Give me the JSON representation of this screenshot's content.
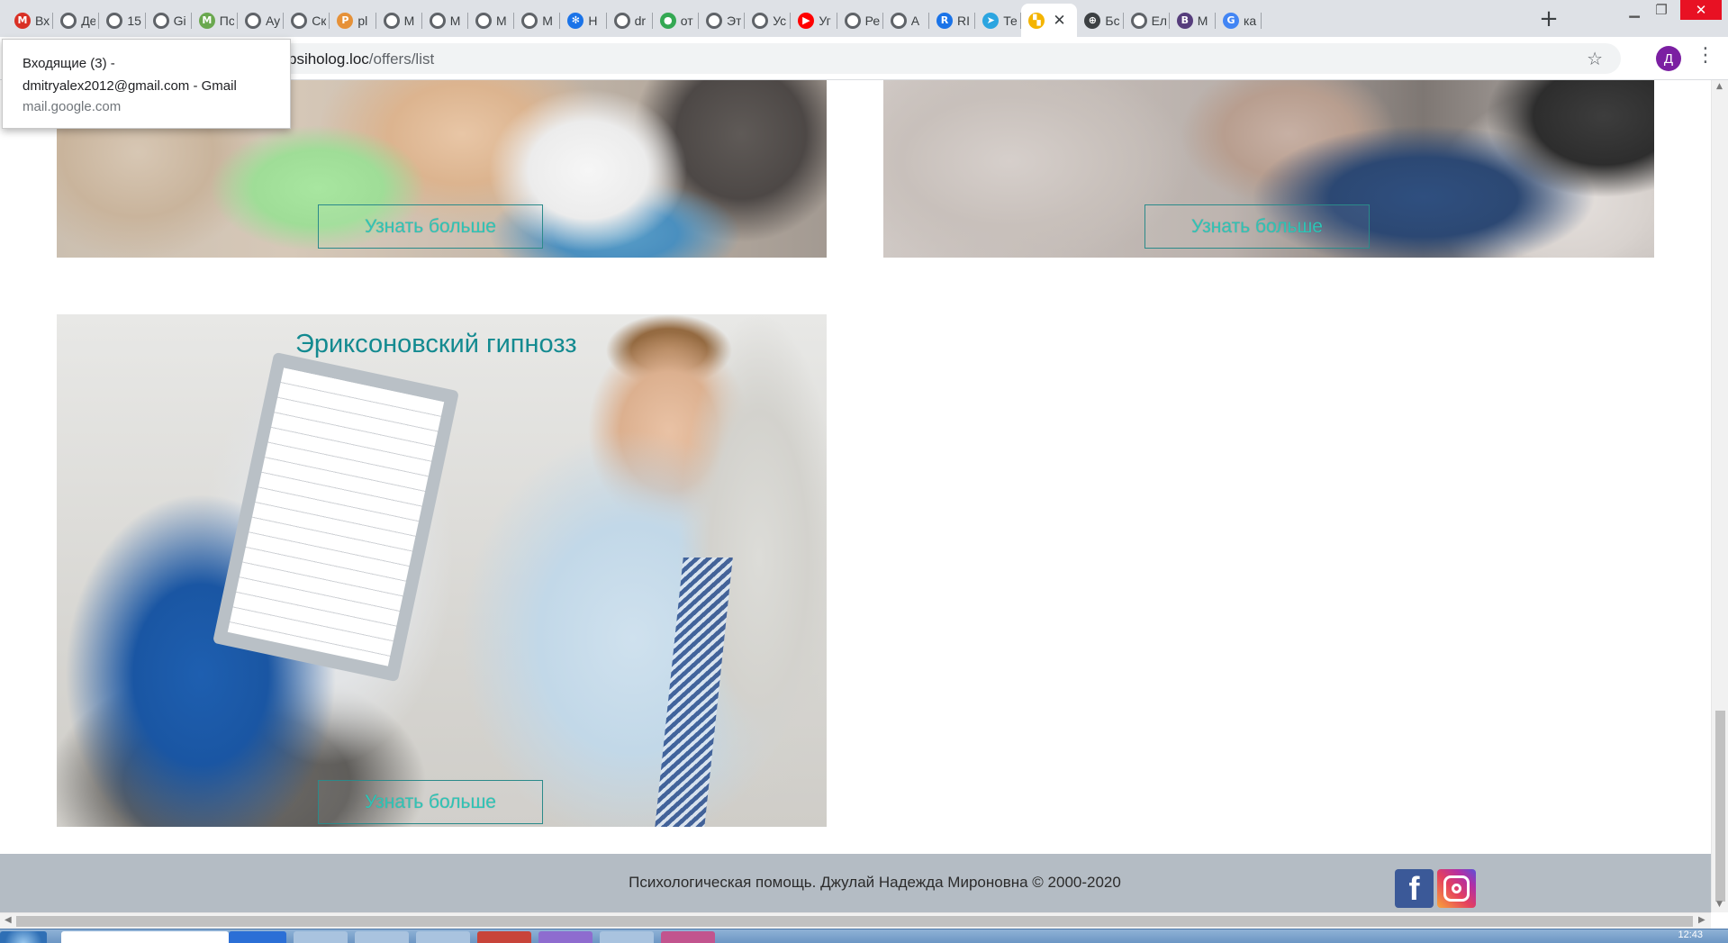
{
  "browser": {
    "tabs": [
      {
        "title": "Входящие (3) - dmitryalex2012@gmail.com - Gmail",
        "icon": "gmail-icon",
        "color": "#d93025",
        "glyph": "M"
      },
      {
        "title": "Де",
        "icon": "globe-icon",
        "color": "#5f6368",
        "glyph": ""
      },
      {
        "title": "15",
        "icon": "globe-icon",
        "color": "#5f6368",
        "glyph": ""
      },
      {
        "title": "Gi",
        "icon": "globe-icon",
        "color": "#5f6368",
        "glyph": ""
      },
      {
        "title": "Пс",
        "icon": "m-logo-icon",
        "color": "#6aa84f",
        "glyph": "M"
      },
      {
        "title": "Ау",
        "icon": "globe-icon",
        "color": "#5f6368",
        "glyph": ""
      },
      {
        "title": "Ск",
        "icon": "globe-icon",
        "color": "#5f6368",
        "glyph": ""
      },
      {
        "title": "pl",
        "icon": "pma-icon",
        "color": "#e69138",
        "glyph": "P"
      },
      {
        "title": "М",
        "icon": "globe-icon",
        "color": "#5f6368",
        "glyph": ""
      },
      {
        "title": "М",
        "icon": "globe-icon",
        "color": "#5f6368",
        "glyph": ""
      },
      {
        "title": "М",
        "icon": "globe-icon",
        "color": "#5f6368",
        "glyph": ""
      },
      {
        "title": "М",
        "icon": "globe-icon",
        "color": "#5f6368",
        "glyph": ""
      },
      {
        "title": "Н",
        "icon": "gear-icon",
        "color": "#1a73e8",
        "glyph": "✻"
      },
      {
        "title": "dr",
        "icon": "globe-icon",
        "color": "#5f6368",
        "glyph": ""
      },
      {
        "title": "от",
        "icon": "maps-pin-icon",
        "color": "#34a853",
        "glyph": "●"
      },
      {
        "title": "Эт",
        "icon": "globe-icon",
        "color": "#5f6368",
        "glyph": ""
      },
      {
        "title": "Ус",
        "icon": "globe-icon",
        "color": "#5f6368",
        "glyph": ""
      },
      {
        "title": "Уг",
        "icon": "youtube-icon",
        "color": "#ff0000",
        "glyph": "▶"
      },
      {
        "title": "Ре",
        "icon": "globe-icon",
        "color": "#5f6368",
        "glyph": ""
      },
      {
        "title": "А",
        "icon": "globe-icon",
        "color": "#5f6368",
        "glyph": ""
      },
      {
        "title": "RI",
        "icon": "ri-logo-icon",
        "color": "#1a73e8",
        "glyph": "R"
      },
      {
        "title": "Те",
        "icon": "telegram-icon",
        "color": "#2ca5e0",
        "glyph": "➤"
      },
      {
        "title": "",
        "icon": "windows-logo-icon",
        "color": "#f4b400",
        "glyph": "▚",
        "active": true
      },
      {
        "title": "Бс",
        "icon": "world-icon",
        "color": "#3c4043",
        "glyph": "⊕"
      },
      {
        "title": "Ел",
        "icon": "globe-icon",
        "color": "#5f6368",
        "glyph": ""
      },
      {
        "title": "М",
        "icon": "bootstrap-icon",
        "color": "#563d7c",
        "glyph": "B"
      },
      {
        "title": "ка",
        "icon": "google-icon",
        "color": "#4285f4",
        "glyph": "G"
      }
    ],
    "new_tab": "+",
    "url_host": "psiholog.loc",
    "url_path": "/offers/list",
    "avatar_letter": "Д",
    "tooltip": {
      "line1": "Входящие (3) -",
      "line2": "dmitryalex2012@gmail.com - Gmail",
      "line3": "mail.google.com"
    }
  },
  "page": {
    "cards": [
      {
        "title": "",
        "button": "Узнать больше"
      },
      {
        "title": "",
        "button": "Узнать больше"
      },
      {
        "title": "Эриксоновский гипнозз",
        "button": "Узнать больше"
      }
    ],
    "footer": {
      "copyright": "Психологическая помощь. Джулай Надежда Мироновна © 2000-2020",
      "facebook": "f"
    }
  },
  "taskbar": {
    "time": "12:43"
  }
}
